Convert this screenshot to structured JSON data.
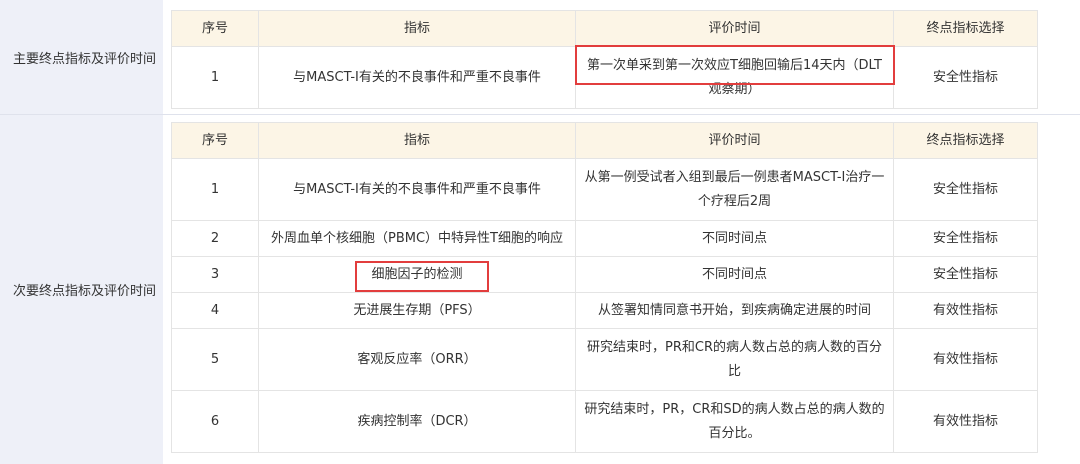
{
  "headers": [
    "序号",
    "指标",
    "评价时间",
    "终点指标选择"
  ],
  "primary": {
    "label": "主要终点指标及评价时间",
    "rows": [
      {
        "no": "1",
        "indicator": "与MASCT-I有关的不良事件和严重不良事件",
        "time": "第一次单采到第一次效应T细胞回输后14天内（DLT观察期）",
        "choice": "安全性指标"
      }
    ]
  },
  "secondary": {
    "label": "次要终点指标及评价时间",
    "rows": [
      {
        "no": "1",
        "indicator": "与MASCT-I有关的不良事件和严重不良事件",
        "time": "从第一例受试者入组到最后一例患者MASCT-I治疗一个疗程后2周",
        "choice": "安全性指标"
      },
      {
        "no": "2",
        "indicator": "外周血单个核细胞（PBMC）中特异性T细胞的响应",
        "time": "不同时间点",
        "choice": "安全性指标"
      },
      {
        "no": "3",
        "indicator": "细胞因子的检测",
        "time": "不同时间点",
        "choice": "安全性指标"
      },
      {
        "no": "4",
        "indicator": "无进展生存期（PFS）",
        "time": "从签署知情同意书开始，到疾病确定进展的时间",
        "choice": "有效性指标"
      },
      {
        "no": "5",
        "indicator": "客观反应率（ORR）",
        "time": "研究结束时，PR和CR的病人数占总的病人数的百分比",
        "choice": "有效性指标"
      },
      {
        "no": "6",
        "indicator": "疾病控制率（DCR）",
        "time": "研究结束时，PR，CR和SD的病人数占总的病人数的百分比。",
        "choice": "有效性指标"
      }
    ]
  },
  "colors": {
    "section_label_bg": "#eef0f8",
    "header_bg": "#fcf5e6",
    "highlight": "#e23d3d",
    "border": "#e4e4e4"
  }
}
